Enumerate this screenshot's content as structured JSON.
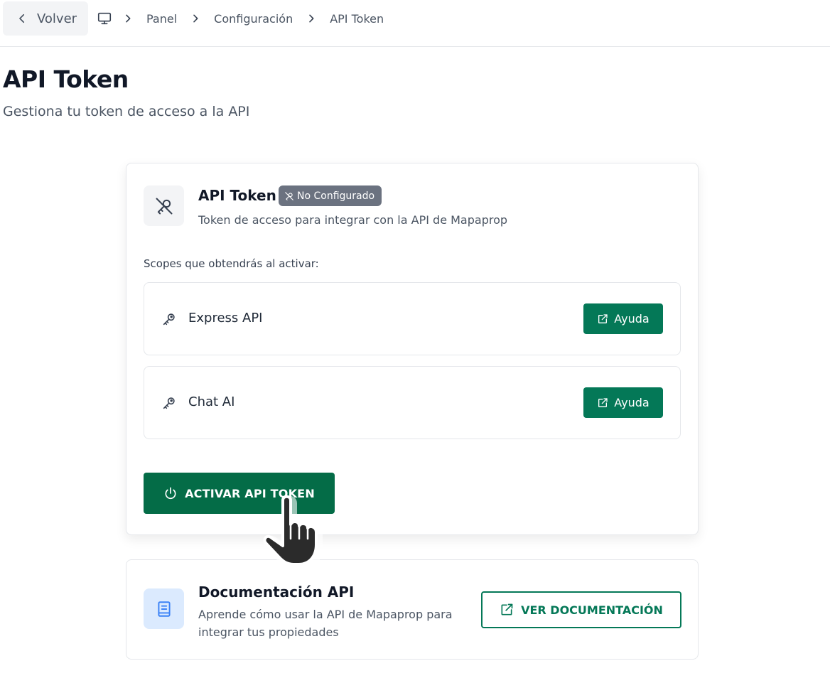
{
  "nav": {
    "back_label": "Volver",
    "breadcrumbs": [
      "Panel",
      "Configuración",
      "API Token"
    ]
  },
  "header": {
    "title": "API Token",
    "subtitle": "Gestiona tu token de acceso a la API"
  },
  "token_card": {
    "title": "API Token",
    "badge": "No Configurado",
    "description": "Token de acceso para integrar con la API de Mapaprop",
    "scopes_label": "Scopes que obtendrás al activar:",
    "scopes": [
      {
        "name": "Express API",
        "action_label": "Ayuda"
      },
      {
        "name": "Chat AI",
        "action_label": "Ayuda"
      }
    ],
    "activate_label": "ACTIVAR API TOKEN"
  },
  "docs_card": {
    "title": "Documentación API",
    "description": "Aprende cómo usar la API de Mapaprop para integrar tus propiedades",
    "button_label": "VER DOCUMENTACIÓN"
  },
  "colors": {
    "primary": "#047857",
    "badge_gray": "#6b7280",
    "docs_tile": "#dbeafe",
    "docs_icon": "#3b82f6"
  },
  "icons": {
    "back": "chevron-left-icon",
    "home": "monitor-icon",
    "separator": "chevron-right-icon",
    "token": "key-off-icon",
    "scope": "key-icon",
    "help": "external-link-icon",
    "activate": "power-icon",
    "docs": "book-icon"
  }
}
